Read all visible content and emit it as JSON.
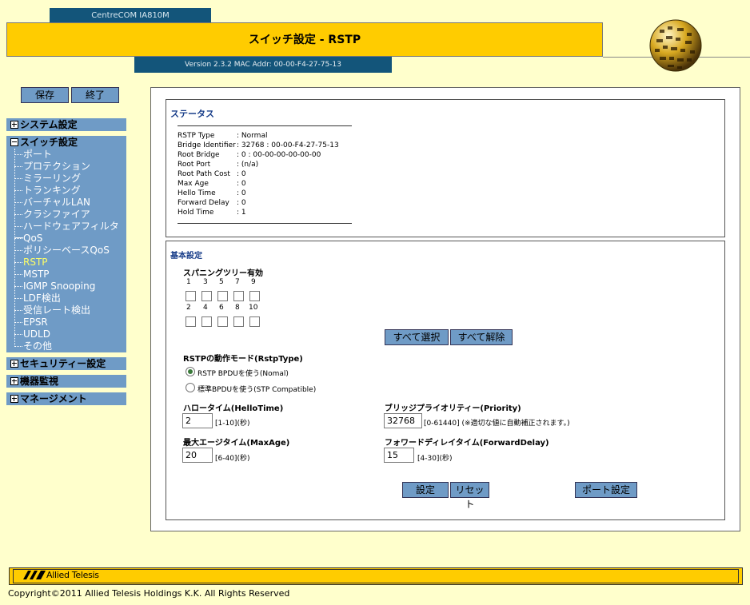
{
  "header": {
    "model": "CentreCOM IA810M",
    "title": "スイッチ設定 - RSTP",
    "version": "Version 2.3.2 MAC Addr: 00-00-F4-27-75-13"
  },
  "toolbar": {
    "save_label": "保存",
    "exit_label": "終了"
  },
  "sidebar": {
    "system": "システム設定",
    "switch": "スイッチ設定",
    "items": [
      "ポート",
      "プロテクション",
      "ミラーリング",
      "トランキング",
      "バーチャルLAN",
      "クラシファイア",
      "ハードウェアフィルター",
      "QoS",
      "ポリシーベースQoS",
      "RSTP",
      "MSTP",
      "IGMP Snooping",
      "LDF検出",
      "受信レート検出",
      "EPSR",
      "UDLD",
      "その他"
    ],
    "active_item": "RSTP",
    "security": "セキュリティー設定",
    "monitor": "機器監視",
    "management": "マネージメント"
  },
  "status": {
    "title": "ステータス",
    "rows": [
      {
        "label": "RSTP Type",
        "value": ": Normal"
      },
      {
        "label": "Bridge Identifier",
        "value": ": 32768 : 00-00-F4-27-75-13"
      },
      {
        "label": "Root Bridge",
        "value": ": 0 : 00-00-00-00-00-00"
      },
      {
        "label": "Root Port",
        "value": ": (n/a)"
      },
      {
        "label": "Root Path Cost",
        "value": ": 0"
      },
      {
        "label": "Max Age",
        "value": ": 0"
      },
      {
        "label": "Hello Time",
        "value": ": 0"
      },
      {
        "label": "Forward Delay",
        "value": ": 0"
      },
      {
        "label": "Hold Time",
        "value": ": 1"
      }
    ]
  },
  "basic": {
    "title": "基本設定",
    "spanning_label": "スパニングツリー有効",
    "top_ports": [
      "1",
      "3",
      "5",
      "7",
      "9"
    ],
    "bottom_ports": [
      "2",
      "4",
      "6",
      "8",
      "10"
    ],
    "select_all": "すべて選択",
    "deselect_all": "すべて解除",
    "mode_label": "RSTPの動作モード(RstpType)",
    "mode_options": [
      "RSTP BPDUを使う(Nomal)",
      "標準BPDUを使う(STP Compatible)"
    ],
    "mode_selected": 0,
    "hello_label": "ハロータイム(HelloTime)",
    "hello_value": "2",
    "hello_range": "[1-10](秒)",
    "priority_label": "ブリッジプライオリティー(Priority)",
    "priority_value": "32768",
    "priority_range": "[0-61440] (※適切な値に自動補正されます。)",
    "maxage_label": "最大エージタイム(MaxAge)",
    "maxage_value": "20",
    "maxage_range": "[6-40](秒)",
    "fwd_label": "フォワードディレイタイム(ForwardDelay)",
    "fwd_value": "15",
    "fwd_range": "[4-30](秒)",
    "apply": "設定",
    "reset": "リセット",
    "port_settings": "ポート設定"
  },
  "footer": {
    "logo": "Allied Telesis",
    "copyright": "Copyright©2011 Allied Telesis Holdings K.K. All Rights Reserved"
  }
}
